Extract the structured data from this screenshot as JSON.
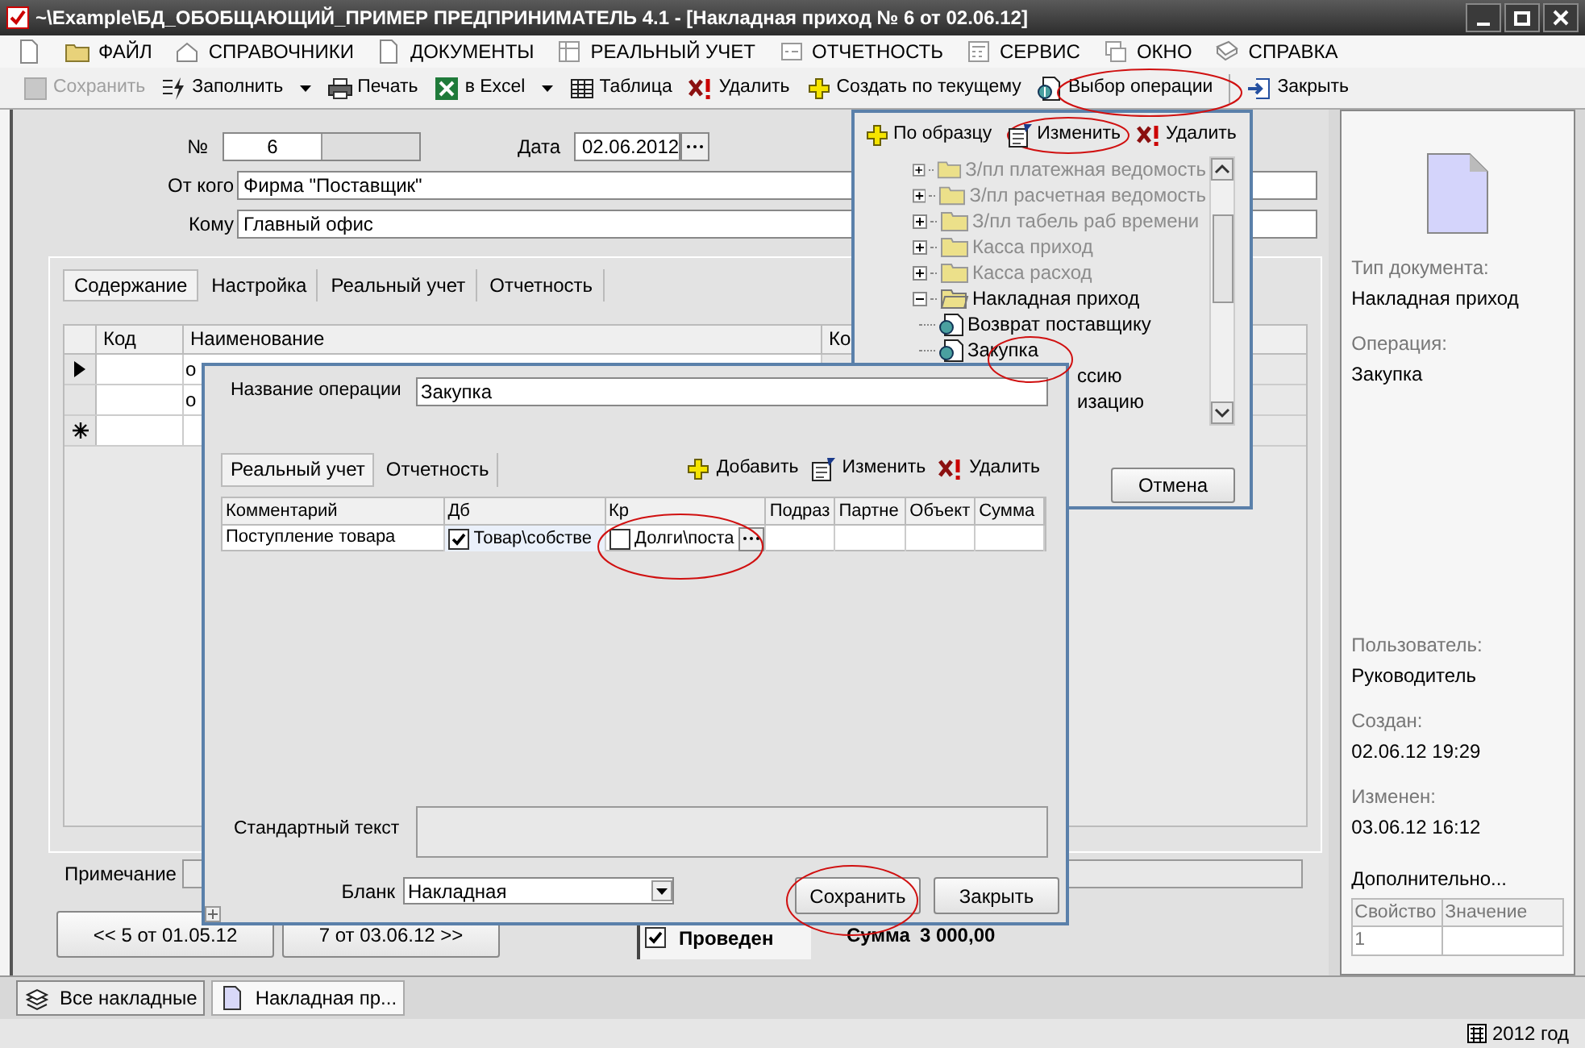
{
  "window": {
    "title": "~\\Example\\БД_ОБОБЩАЮЩИЙ_ПРИМЕР  ПРЕДПРИНИМАТЕЛЬ 4.1 - [Накладная приход № 6 от 02.06.12]"
  },
  "menu": [
    {
      "label": "ФАЙЛ"
    },
    {
      "label": "СПРАВОЧНИКИ"
    },
    {
      "label": "ДОКУМЕНТЫ"
    },
    {
      "label": "РЕАЛЬНЫЙ УЧЕТ"
    },
    {
      "label": "ОТЧЕТНОСТЬ"
    },
    {
      "label": "СЕРВИС"
    },
    {
      "label": "ОКНО"
    },
    {
      "label": "СПРАВКА"
    }
  ],
  "toolbar": [
    {
      "label": "Сохранить",
      "disabled": true,
      "dropdown": false
    },
    {
      "label": "Заполнить",
      "disabled": false,
      "dropdown": true
    },
    {
      "label": "Печать",
      "disabled": false,
      "dropdown": false
    },
    {
      "label": "в Excel",
      "disabled": false,
      "dropdown": true
    },
    {
      "label": "Таблица",
      "disabled": false,
      "dropdown": false
    },
    {
      "label": "Удалить",
      "disabled": false,
      "dropdown": false
    },
    {
      "label": "Создать по текущему",
      "disabled": false,
      "dropdown": false
    },
    {
      "label": "Выбор операции",
      "disabled": false,
      "dropdown": false
    },
    {
      "label": "Закрыть",
      "disabled": false,
      "dropdown": false
    }
  ],
  "form": {
    "number": {
      "label": "№",
      "value": "6"
    },
    "date": {
      "label": "Дата",
      "value": "02.06.2012"
    },
    "from": {
      "label": "От кого",
      "value": "Фирма \"Поставщик\""
    },
    "to": {
      "label": "Кому",
      "value": "Главный офис"
    }
  },
  "tabs": [
    {
      "label": "Содержание",
      "selected": true
    },
    {
      "label": "Настройка",
      "selected": false
    },
    {
      "label": "Реальный учет",
      "selected": false
    },
    {
      "label": "Отчетность",
      "selected": false
    }
  ],
  "grid": {
    "columns": [
      "Код",
      "Наименование",
      "Ко"
    ],
    "rows": [
      {
        "kind": "current",
        "name": "о"
      },
      {
        "kind": "plain",
        "name": "о"
      },
      {
        "kind": "new"
      }
    ]
  },
  "note": {
    "label": "Примечание"
  },
  "nav": [
    {
      "label": "<< 5 от 01.05.12"
    },
    {
      "label": "7 от 03.06.12 >>"
    }
  ],
  "posted": {
    "label": "Проведен",
    "checked": true
  },
  "total": {
    "label": "Сумма",
    "value": "3 000,00"
  },
  "bottom_tabs": [
    {
      "label": "Все накладные",
      "selected": false
    },
    {
      "label": "Накладная пр...",
      "selected": true
    }
  ],
  "status_bar": {
    "year": "2012 год"
  },
  "side_panel": {
    "fields": [
      {
        "label": "Тип документа:",
        "value": "Накладная приход"
      },
      {
        "label": "Операция:",
        "value": "Закупка"
      },
      {
        "label": "Пользователь:",
        "value": "Руководитель"
      },
      {
        "label": "Создан:",
        "value": "02.06.12  19:29"
      },
      {
        "label": "Изменен:",
        "value": "03.06.12  16:12"
      }
    ],
    "extra": {
      "title": "Дополнительно...",
      "columns": [
        "Свойство",
        "Значение"
      ],
      "rows": [
        {
          "property": "1"
        }
      ]
    }
  },
  "operation_picker": {
    "toolbar": [
      {
        "label": "По образцу"
      },
      {
        "label": "Изменить"
      },
      {
        "label": "Удалить"
      }
    ],
    "tree": [
      {
        "label": "З/пл платежная ведомость",
        "dimmed": true,
        "expanded": false
      },
      {
        "label": "З/пл расчетная ведомость",
        "dimmed": true,
        "expanded": false
      },
      {
        "label": "З/пл табель раб времени",
        "dimmed": true,
        "expanded": false
      },
      {
        "label": "Касса приход",
        "dimmed": true,
        "expanded": false
      },
      {
        "label": "Касса расход",
        "dimmed": true,
        "expanded": false
      },
      {
        "label": "Накладная приход",
        "dimmed": false,
        "expanded": true,
        "children": [
          {
            "label": "Возврат поставщику",
            "kind": "operation"
          },
          {
            "label": "Закупка",
            "kind": "operation"
          },
          {
            "label": "ссию",
            "kind": "partial"
          },
          {
            "label": "изацию",
            "kind": "partial"
          }
        ]
      }
    ],
    "cancel": "Отмена"
  },
  "operation_dialog": {
    "name": {
      "label": "Название операции",
      "value": "Закупка"
    },
    "tabs": [
      {
        "label": "Реальный учет",
        "selected": true
      },
      {
        "label": "Отчетность",
        "selected": false
      }
    ],
    "toolbar": [
      {
        "label": "Добавить"
      },
      {
        "label": "Изменить"
      },
      {
        "label": "Удалить"
      }
    ],
    "columns": [
      "Комментарий",
      "Дб",
      "Кр",
      "Подраз",
      "Партне",
      "Объект",
      "Сумма"
    ],
    "rows": [
      {
        "comment": "Поступление товара",
        "debit": {
          "text": "Товар\\собстве",
          "checked": true
        },
        "credit": {
          "text": "Долги\\поста",
          "checked": false
        }
      }
    ],
    "standard_text": {
      "label": "Стандартный текст"
    },
    "blank": {
      "label": "Бланк",
      "value": "Накладная"
    },
    "buttons": [
      "Сохранить",
      "Закрыть"
    ]
  }
}
